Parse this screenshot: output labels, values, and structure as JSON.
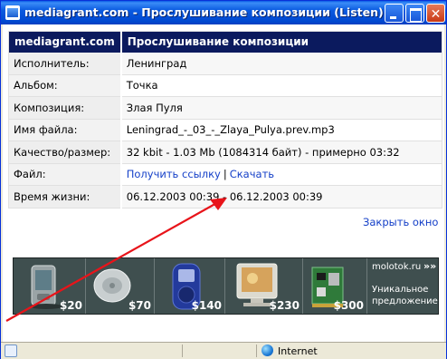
{
  "window": {
    "title": "mediagrant.com - Прослушивание композиции (Listen) -",
    "close_glyph": "✕"
  },
  "table": {
    "header_site": "mediagrant.com",
    "header_title": "Прослушивание композиции",
    "rows": [
      {
        "label": "Исполнитель:",
        "value": "Ленинград"
      },
      {
        "label": "Альбом:",
        "value": "Точка"
      },
      {
        "label": "Композиция:",
        "value": "Злая Пуля"
      },
      {
        "label": "Имя файла:",
        "value": "Leningrad_-_03_-_Zlaya_Pulya.prev.mp3"
      },
      {
        "label": "Качество/размер:",
        "value": "32 kbit - 1.03 Mb (1084314 байт) - примерно 03:32"
      },
      {
        "label": "Файл:",
        "link_get": "Получить ссылку",
        "separator": "|",
        "link_download": "Скачать"
      },
      {
        "label": "Время жизни:",
        "value": "06.12.2003 00:39 - 06.12.2003 00:39"
      }
    ]
  },
  "close_link": "Закрыть окно",
  "banner": {
    "items": [
      {
        "price": "$20",
        "icon": "pda-icon"
      },
      {
        "price": "$70",
        "icon": "cd-player-icon"
      },
      {
        "price": "$140",
        "icon": "mp3-player-icon"
      },
      {
        "price": "$230",
        "icon": "monitor-icon"
      },
      {
        "price": "$300",
        "icon": "tv-tuner-card-icon"
      }
    ],
    "site": "molotok.ru",
    "arrows": "»»",
    "tagline1": "Уникальное",
    "tagline2": "предложение"
  },
  "status": {
    "zone": "Internet"
  },
  "annotation": {
    "color": "#e8141a"
  }
}
